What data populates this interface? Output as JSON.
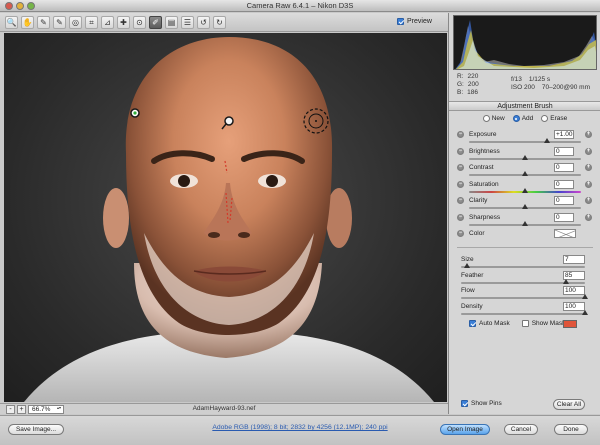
{
  "window": {
    "title": "Camera Raw 6.4.1  –  Nikon D3S"
  },
  "toolbar": {
    "tools": [
      {
        "name": "zoom-tool",
        "glyph": "🔍"
      },
      {
        "name": "hand-tool",
        "glyph": "✋"
      },
      {
        "name": "white-balance-tool",
        "glyph": "✎"
      },
      {
        "name": "color-sampler-tool",
        "glyph": "✎"
      },
      {
        "name": "targeted-adjustment-tool",
        "glyph": "◎"
      },
      {
        "name": "crop-tool",
        "glyph": "⌗"
      },
      {
        "name": "straighten-tool",
        "glyph": "⊿"
      },
      {
        "name": "spot-removal-tool",
        "glyph": "✚"
      },
      {
        "name": "red-eye-tool",
        "glyph": "⊙"
      },
      {
        "name": "adjustment-brush-tool",
        "glyph": "✐"
      },
      {
        "name": "graduated-filter-tool",
        "glyph": "▤"
      },
      {
        "name": "preferences-tool",
        "glyph": "☰"
      },
      {
        "name": "rotate-left-tool",
        "glyph": "↺"
      },
      {
        "name": "rotate-right-tool",
        "glyph": "↻"
      }
    ],
    "preview_label": "Preview",
    "preview_checked": true
  },
  "readout": {
    "r_label": "R:",
    "r_value": "220",
    "g_label": "G:",
    "g_value": "200",
    "b_label": "B:",
    "b_value": "186",
    "aperture": "f/13",
    "shutter": "1/125 s",
    "iso": "ISO 200",
    "lens": "70–200@90 mm"
  },
  "adjustment_brush": {
    "title": "Adjustment Brush",
    "modes": [
      {
        "label": "New",
        "selected": false
      },
      {
        "label": "Add",
        "selected": true
      },
      {
        "label": "Erase",
        "selected": false
      }
    ],
    "sliders": [
      {
        "label": "Exposure",
        "value": "+1.00",
        "pos": 0.7
      },
      {
        "label": "Brightness",
        "value": "0",
        "pos": 0.5
      },
      {
        "label": "Contrast",
        "value": "0",
        "pos": 0.5
      },
      {
        "label": "Saturation",
        "value": "0",
        "pos": 0.5
      },
      {
        "label": "Clarity",
        "value": "0",
        "pos": 0.5
      },
      {
        "label": "Sharpness",
        "value": "0",
        "pos": 0.5
      }
    ],
    "color_label": "Color",
    "brush": [
      {
        "label": "Size",
        "value": "7",
        "pos": 0.05
      },
      {
        "label": "Feather",
        "value": "85",
        "pos": 0.85
      },
      {
        "label": "Flow",
        "value": "100",
        "pos": 1.0
      },
      {
        "label": "Density",
        "value": "100",
        "pos": 1.0
      }
    ],
    "auto_mask_label": "Auto Mask",
    "auto_mask_checked": true,
    "show_mask_label": "Show Mask",
    "show_mask_checked": false,
    "mask_color": "#e0553a",
    "show_pins_label": "Show Pins",
    "show_pins_checked": true,
    "clear_all_label": "Clear All"
  },
  "status": {
    "zoom_minus": "-",
    "zoom_plus": "+",
    "zoom_value": "66.7%",
    "filename": "AdamHayward-93.nef"
  },
  "footer": {
    "save_label": "Save Image...",
    "workflow_text": "Adobe RGB (1998); 8 bit; 2832 by 4256 (12.1MP); 240 ppi",
    "open_label": "Open Image",
    "cancel_label": "Cancel",
    "done_label": "Done"
  }
}
